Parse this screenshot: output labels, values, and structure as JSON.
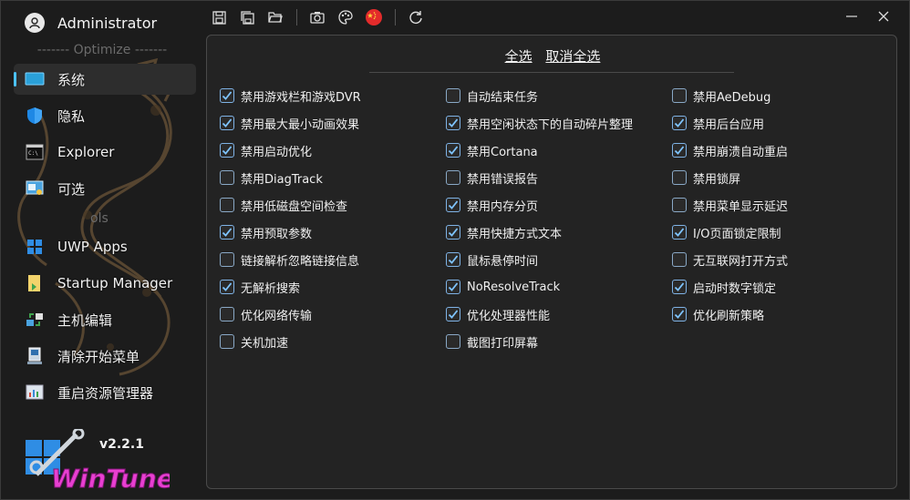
{
  "user": {
    "name": "Administrator"
  },
  "sections": {
    "optimize": "------- Optimize -------",
    "tools": "ols"
  },
  "nav": [
    {
      "label": "系统",
      "icon": "monitor-icon"
    },
    {
      "label": "隐私",
      "icon": "shield-icon"
    },
    {
      "label": "Explorer",
      "icon": "terminal-icon"
    },
    {
      "label": "可选",
      "icon": "settings-window-icon"
    },
    {
      "label": "UWP Apps",
      "icon": "windows-logo-icon"
    },
    {
      "label": "Startup Manager",
      "icon": "startup-folder-icon"
    },
    {
      "label": "主机编辑",
      "icon": "network-icon"
    },
    {
      "label": "清除开始菜单",
      "icon": "computer-icon"
    },
    {
      "label": "重启资源管理器",
      "icon": "resource-manager-icon"
    }
  ],
  "version": "v2.2.1",
  "logo_text": "WinTune",
  "toolbar": [
    "save-icon",
    "save-all-icon",
    "open-folder-icon",
    "screenshot-icon",
    "palette-icon",
    "china-flag-icon",
    "refresh-icon"
  ],
  "select": {
    "all": "全选",
    "none": "取消全选"
  },
  "options": {
    "col1": [
      {
        "label": "禁用游戏栏和游戏DVR",
        "checked": true
      },
      {
        "label": "禁用最大最小动画效果",
        "checked": true
      },
      {
        "label": "禁用启动优化",
        "checked": true
      },
      {
        "label": "禁用DiagTrack",
        "checked": false
      },
      {
        "label": "禁用低磁盘空间检查",
        "checked": false
      },
      {
        "label": "禁用预取参数",
        "checked": true
      },
      {
        "label": "链接解析忽略链接信息",
        "checked": false
      },
      {
        "label": "无解析搜索",
        "checked": true
      },
      {
        "label": "优化网络传输",
        "checked": false
      },
      {
        "label": "关机加速",
        "checked": false
      }
    ],
    "col2": [
      {
        "label": "自动结束任务",
        "checked": false
      },
      {
        "label": "禁用空闲状态下的自动碎片整理",
        "checked": true
      },
      {
        "label": "禁用Cortana",
        "checked": true
      },
      {
        "label": "禁用错误报告",
        "checked": false
      },
      {
        "label": "禁用内存分页",
        "checked": true
      },
      {
        "label": "禁用快捷方式文本",
        "checked": true
      },
      {
        "label": "鼠标悬停时间",
        "checked": true
      },
      {
        "label": "NoResolveTrack",
        "checked": true
      },
      {
        "label": "优化处理器性能",
        "checked": true
      },
      {
        "label": "截图打印屏幕",
        "checked": false
      }
    ],
    "col3": [
      {
        "label": "禁用AeDebug",
        "checked": false
      },
      {
        "label": "禁用后台应用",
        "checked": true
      },
      {
        "label": "禁用崩溃自动重启",
        "checked": true
      },
      {
        "label": "禁用锁屏",
        "checked": false
      },
      {
        "label": "禁用菜单显示延迟",
        "checked": false
      },
      {
        "label": "I/O页面锁定限制",
        "checked": true
      },
      {
        "label": "无互联网打开方式",
        "checked": false
      },
      {
        "label": "启动时数字锁定",
        "checked": true
      },
      {
        "label": "优化刷新策略",
        "checked": true
      }
    ]
  },
  "colors": {
    "accent": "#4cc2ff",
    "panel": "#232323",
    "bg": "#1c1c1c"
  }
}
